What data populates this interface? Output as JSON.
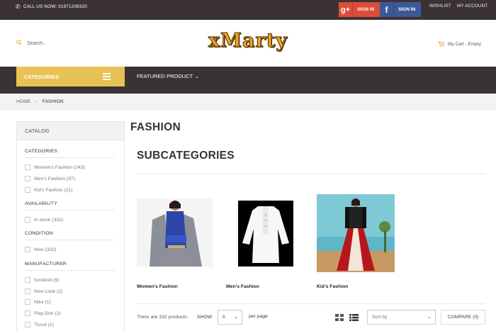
{
  "topbar": {
    "call_text": "CALL US NOW: 01971208320",
    "google_signin_label": "SIGN IN",
    "facebook_signin_label": "SIGN IN",
    "wishlist_label": "WISHLIST",
    "account_label": "MY ACCOUNT"
  },
  "header": {
    "logo_text": "xMarty",
    "search_placeholder": "Search...",
    "cart_label": "My Cart - Empty"
  },
  "nav": {
    "categories_label": "CATEGORIES",
    "featured_label": "FEATURED PRODUCT"
  },
  "breadcrumb": {
    "home": "HOME",
    "current": "FASHION"
  },
  "sidebar": {
    "title": "CATALOG",
    "facets": [
      {
        "title": "CATEGORIES",
        "items": [
          "Women's Fashion (243)",
          "Men's Fashion (37)",
          "Kid's Fashion (21)"
        ]
      },
      {
        "title": "AVAILABILITY",
        "items": [
          "In stock (332)"
        ]
      },
      {
        "title": "CONDITION",
        "items": [
          "New (332)"
        ]
      },
      {
        "title": "MANUFACTURER",
        "items": [
          "funskool (9)",
          "New Look (2)",
          "Nike (1)",
          "Play Doh (2)",
          "Tissot (1)"
        ]
      }
    ]
  },
  "main": {
    "page_title": "FASHION",
    "subcategories_title": "SUBCATEGORIES",
    "subcategories": [
      {
        "label": "Women's Fashion"
      },
      {
        "label": "Men's Fashion"
      },
      {
        "label": "Kid's Fashion"
      }
    ]
  },
  "toolbar": {
    "count_text": "There are 332 products.",
    "show_label": "SHOW",
    "show_value": "6",
    "per_page_label": "per page",
    "sort_placeholder": "Sort by",
    "compare_label": "COMPARE (0)"
  },
  "colors": {
    "dark_bar": "#3b3333",
    "accent_yellow": "#e9c255",
    "google_red": "#dd4b39",
    "facebook_blue": "#3b5998",
    "logo_orange": "#f7a21a"
  }
}
